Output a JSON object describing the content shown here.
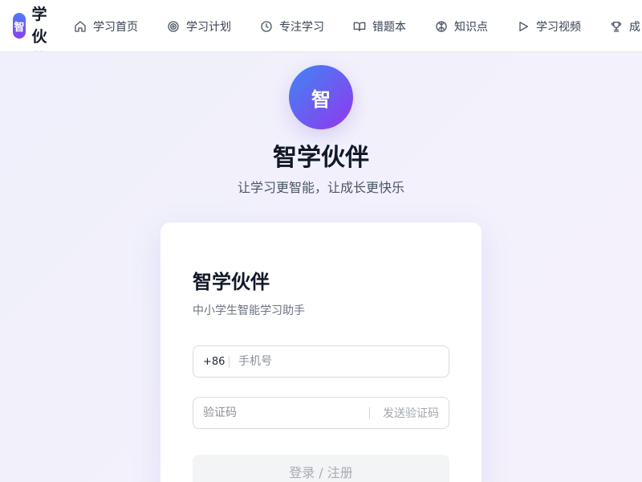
{
  "brand": {
    "logo_char": "智",
    "name": "学伙伴"
  },
  "nav": {
    "items": [
      {
        "label": "学习首页",
        "icon": "home-icon"
      },
      {
        "label": "学习计划",
        "icon": "target-icon"
      },
      {
        "label": "专注学习",
        "icon": "clock-icon"
      },
      {
        "label": "错题本",
        "icon": "book-icon"
      },
      {
        "label": "知识点",
        "icon": "brain-icon"
      },
      {
        "label": "学习视频",
        "icon": "play-icon"
      },
      {
        "label": "成",
        "icon": "trophy-icon"
      }
    ]
  },
  "hero": {
    "logo_char": "智",
    "title": "智学伙伴",
    "subtitle": "让学习更智能，让成长更快乐"
  },
  "login": {
    "title": "智学伙伴",
    "subtitle": "中小学生智能学习助手",
    "phone_prefix": "+86",
    "phone_placeholder": "手机号",
    "code_placeholder": "验证码",
    "send_code_label": "发送验证码",
    "submit_label": "登录 / 注册"
  },
  "colors": {
    "brand_gradient_start": "#3f86f3",
    "brand_gradient_end": "#9237ee",
    "page_background": "#eef0fb",
    "button_disabled_bg": "#f3f4f6"
  }
}
